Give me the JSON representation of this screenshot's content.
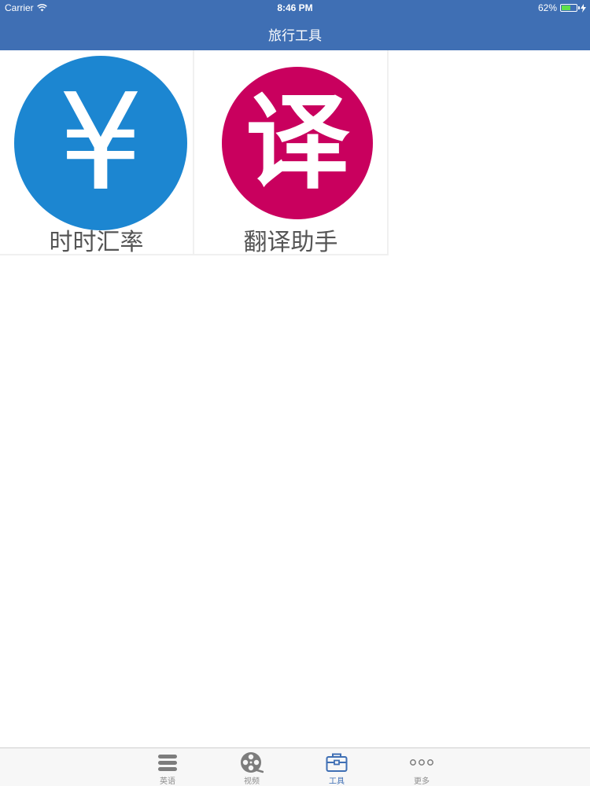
{
  "status_bar": {
    "carrier": "Carrier",
    "time": "8:46 PM",
    "battery_text": "62%",
    "battery_level": 0.62
  },
  "nav": {
    "title": "旅行工具"
  },
  "tools": [
    {
      "label": "时时汇率",
      "glyph": "¥",
      "icon": "yen-icon",
      "color": "#1c86d1"
    },
    {
      "label": "翻译助手",
      "glyph": "译",
      "icon": "translate-icon",
      "color": "#c9005e"
    }
  ],
  "tabs": [
    {
      "label": "英语",
      "icon": "menu-lines-icon",
      "active": false
    },
    {
      "label": "视频",
      "icon": "film-reel-icon",
      "active": false
    },
    {
      "label": "工具",
      "icon": "toolbox-icon",
      "active": true
    },
    {
      "label": "更多",
      "icon": "more-dots-icon",
      "active": false
    }
  ],
  "colors": {
    "accent": "#3f6fb4",
    "tab_inactive": "#8e8e8e"
  }
}
